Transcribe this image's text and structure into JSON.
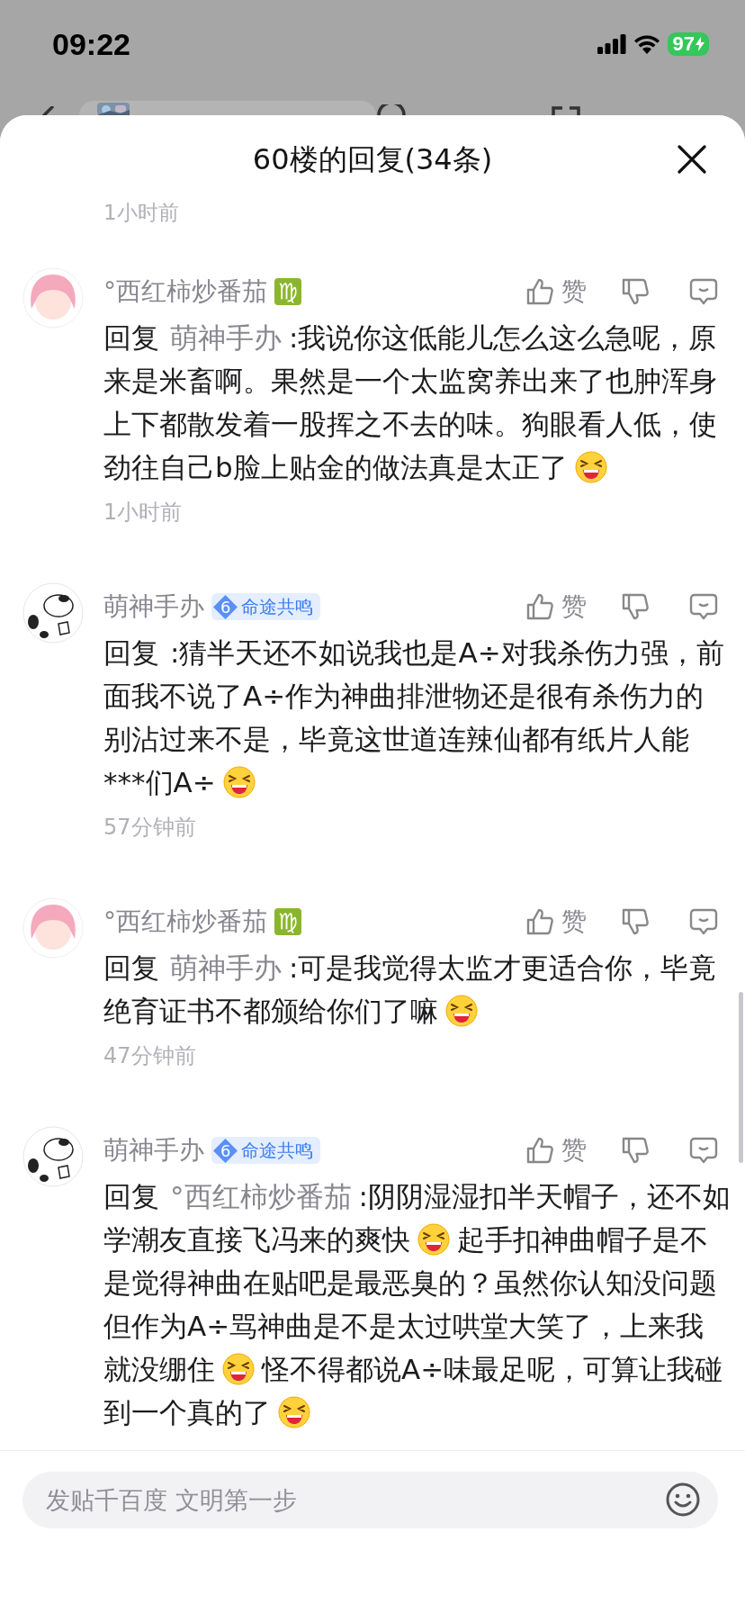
{
  "status_bar": {
    "time": "09:22",
    "battery": "97"
  },
  "sheet": {
    "title": "60楼的回复(34条)",
    "cut_time": "1小时前"
  },
  "comments": [
    {
      "author": "°西红柿炒番茄",
      "avatar": {
        "kind": "girl"
      },
      "badge": {
        "kind": "zodiac",
        "symbol": "♍"
      },
      "like_label": "赞",
      "time": "1小时前",
      "body": [
        {
          "kind": "prefix",
          "text": "回复"
        },
        {
          "kind": "mention",
          "text": "萌神手办"
        },
        {
          "kind": "text",
          "text": ":我说你这低能儿怎么这么急呢，原来是米畜啊。果然是一个太监窝养出来了也肿浑身上下都散发着一股挥之不去的味。狗眼看人低，使劲往自己b脸上贴金的做法真是太正了"
        },
        {
          "kind": "emoji"
        }
      ]
    },
    {
      "author": "萌神手办",
      "avatar": {
        "kind": "cow"
      },
      "badge": {
        "kind": "level",
        "number": "6",
        "title": "命途共鸣"
      },
      "like_label": "赞",
      "time": "57分钟前",
      "body": [
        {
          "kind": "prefix",
          "text": "回复"
        },
        {
          "kind": "text",
          "text": ":猜半天还不如说我也是A÷对我杀伤力强，前面我不说了A÷作为神曲排泄物还是很有杀伤力的别沾过来不是，毕竟这世道连辣仙都有纸片人能***们A÷"
        },
        {
          "kind": "emoji"
        }
      ]
    },
    {
      "author": "°西红柿炒番茄",
      "avatar": {
        "kind": "girl"
      },
      "badge": {
        "kind": "zodiac",
        "symbol": "♍"
      },
      "like_label": "赞",
      "time": "47分钟前",
      "body": [
        {
          "kind": "prefix",
          "text": "回复"
        },
        {
          "kind": "mention",
          "text": "萌神手办"
        },
        {
          "kind": "text",
          "text": ":可是我觉得太监才更适合你，毕竟绝育证书不都颁给你们了嘛"
        },
        {
          "kind": "emoji"
        }
      ]
    },
    {
      "author": "萌神手办",
      "avatar": {
        "kind": "cow"
      },
      "badge": {
        "kind": "level",
        "number": "6",
        "title": "命途共鸣"
      },
      "like_label": "赞",
      "body": [
        {
          "kind": "prefix",
          "text": "回复"
        },
        {
          "kind": "mention",
          "text": "°西红柿炒番茄"
        },
        {
          "kind": "text",
          "text": ":阴阴湿湿扣半天帽子，还不如学潮友直接飞冯来的爽快"
        },
        {
          "kind": "emoji"
        },
        {
          "kind": "text",
          "text": "起手扣神曲帽子是不是觉得神曲在贴吧是最恶臭的？虽然你认知没问题但作为A÷骂神曲是不是太过哄堂大笑了，上来我就没绷住"
        },
        {
          "kind": "emoji"
        },
        {
          "kind": "text",
          "text": "怪不得都说A÷味最足呢，可算让我碰到一个真的了"
        },
        {
          "kind": "emoji"
        }
      ]
    }
  ],
  "input": {
    "placeholder": "发贴千百度 文明第一步"
  }
}
